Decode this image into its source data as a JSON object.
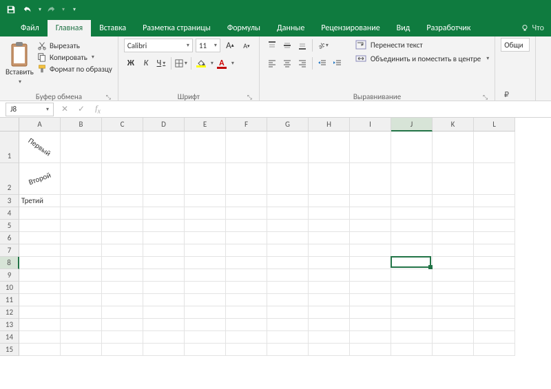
{
  "quickAccess": {
    "save": "save-icon",
    "undo": "undo-icon",
    "redo": "redo-icon",
    "custom": "customize-icon"
  },
  "tabs": [
    "Файл",
    "Главная",
    "Вставка",
    "Разметка страницы",
    "Формулы",
    "Данные",
    "Рецензирование",
    "Вид",
    "Разработчик"
  ],
  "activeTab": 1,
  "tellMe": "Что",
  "ribbon": {
    "clipboard": {
      "paste": "Вставить",
      "cut": "Вырезать",
      "copy": "Копировать",
      "formatPainter": "Формат по образцу",
      "label": "Буфер обмена"
    },
    "font": {
      "name": "Calibri",
      "size": "11",
      "increase": "A▲",
      "decrease": "A▼",
      "bold": "Ж",
      "italic": "К",
      "underline": "Ч",
      "label": "Шрифт"
    },
    "alignment": {
      "wrap": "Перенести текст",
      "merge": "Объединить и поместить в центре",
      "label": "Выравнивание"
    },
    "number": {
      "general": "Общи"
    }
  },
  "nameBox": "J8",
  "formula": "",
  "columns": [
    "A",
    "B",
    "C",
    "D",
    "E",
    "F",
    "G",
    "H",
    "I",
    "J",
    "K",
    "L"
  ],
  "activeColumn": "J",
  "rows": [
    1,
    2,
    3,
    4,
    5,
    6,
    7,
    8,
    9,
    10,
    11,
    12,
    13,
    14,
    15
  ],
  "activeRow": 8,
  "tallRows": [
    1,
    2
  ],
  "cells": {
    "A1": {
      "text": "Первый",
      "rot": "rot45"
    },
    "A2": {
      "text": "Второй",
      "rot": "rotn25"
    },
    "A3": {
      "text": "Третий",
      "rot": ""
    }
  },
  "activeCell": "J8"
}
